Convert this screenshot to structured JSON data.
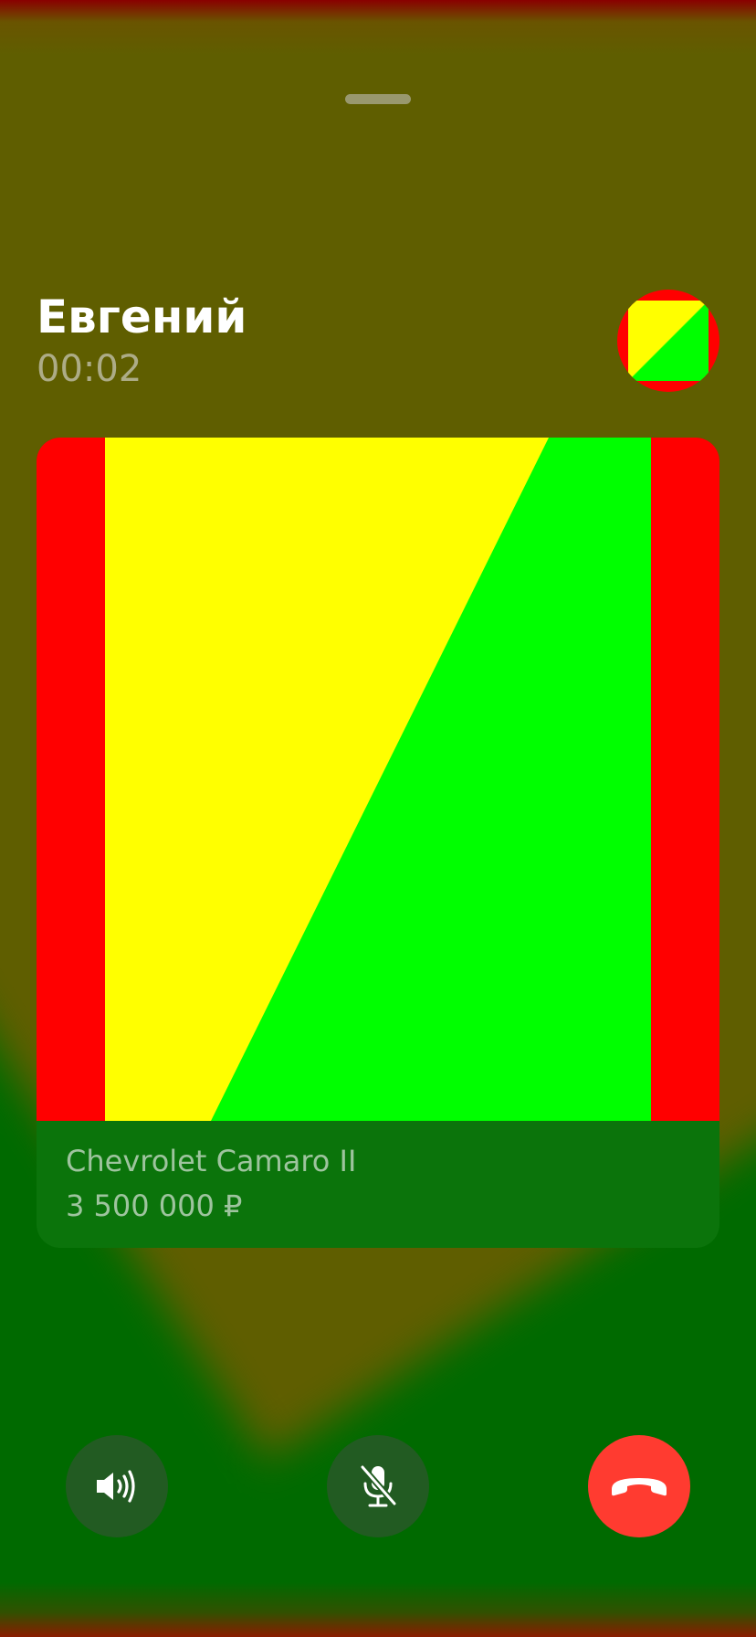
{
  "call": {
    "caller_name": "Евгений",
    "duration": "00:02",
    "avatar_icon": "contact-avatar"
  },
  "listing": {
    "title": "Chevrolet Camaro II",
    "price": "3 500 000 ₽"
  },
  "controls": {
    "speaker_icon": "speaker-icon",
    "mute_icon": "mic-off-icon",
    "hangup_icon": "phone-hangup-icon"
  },
  "colors": {
    "background_top": "#5f5e00",
    "background_bottom": "#006a00",
    "hangup": "#ff3b30",
    "control_bg": "#225b22",
    "placeholder_red": "#ff0000",
    "placeholder_yellow": "#ffff00",
    "placeholder_green": "#00ff00"
  }
}
